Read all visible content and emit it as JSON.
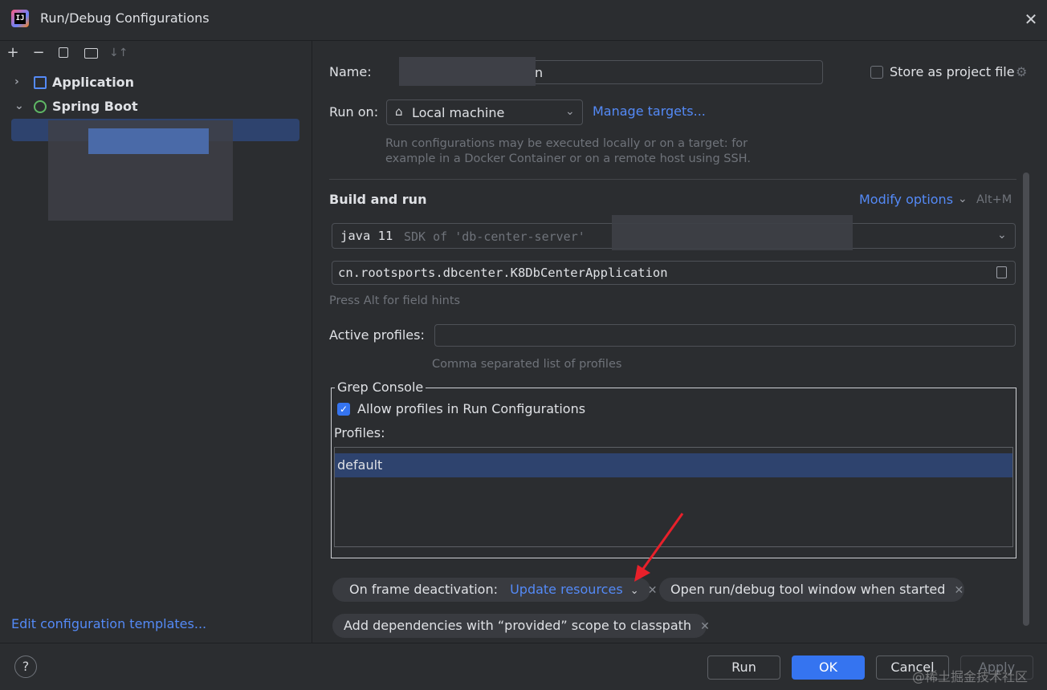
{
  "window": {
    "title": "Run/Debug Configurations",
    "logo_text": "IJ"
  },
  "tree": {
    "items": [
      {
        "label": "Application",
        "icon": "application-icon"
      },
      {
        "label": "Spring Boot",
        "icon": "spring-boot-icon"
      }
    ],
    "edit_templates": "Edit configuration templates..."
  },
  "form": {
    "name_label": "Name:",
    "name_value": "n",
    "store_label": "Store as project file",
    "run_on_label": "Run on:",
    "run_on_value": "Local machine",
    "manage_targets": "Manage targets...",
    "run_on_hint_1": "Run configurations may be executed locally or on a target: for",
    "run_on_hint_2": "example in a Docker Container or on a remote host using SSH.",
    "build_and_run": "Build and run",
    "modify_options": "Modify options",
    "modify_shortcut": "Alt+M",
    "jdk_version": "java 11",
    "jdk_detail": "SDK of 'db-center-server'",
    "main_class": "cn.rootsports.dbcenter.K8DbCenterApplication",
    "field_hint": "Press Alt for field hints",
    "active_profiles_label": "Active profiles:",
    "active_profiles_value": "",
    "active_profiles_hint": "Comma separated list of profiles",
    "grep_console": "Grep Console",
    "allow_profiles": "Allow profiles in Run Configurations",
    "profiles_label": "Profiles:",
    "profiles": [
      "default"
    ]
  },
  "chips": {
    "frame_deactivation_label": "On frame deactivation:",
    "frame_deactivation_value": "Update resources",
    "open_tool_window": "Open run/debug tool window when started",
    "add_dependencies": "Add dependencies with “provided” scope to classpath"
  },
  "buttons": {
    "help": "?",
    "run": "Run",
    "ok": "OK",
    "cancel": "Cancel",
    "apply": "Apply"
  },
  "watermark": "@稀土掘金技术社区",
  "colors": {
    "background": "#2b2d30",
    "accent": "#3574f0",
    "link": "#548af7",
    "selection": "#2e436e"
  }
}
